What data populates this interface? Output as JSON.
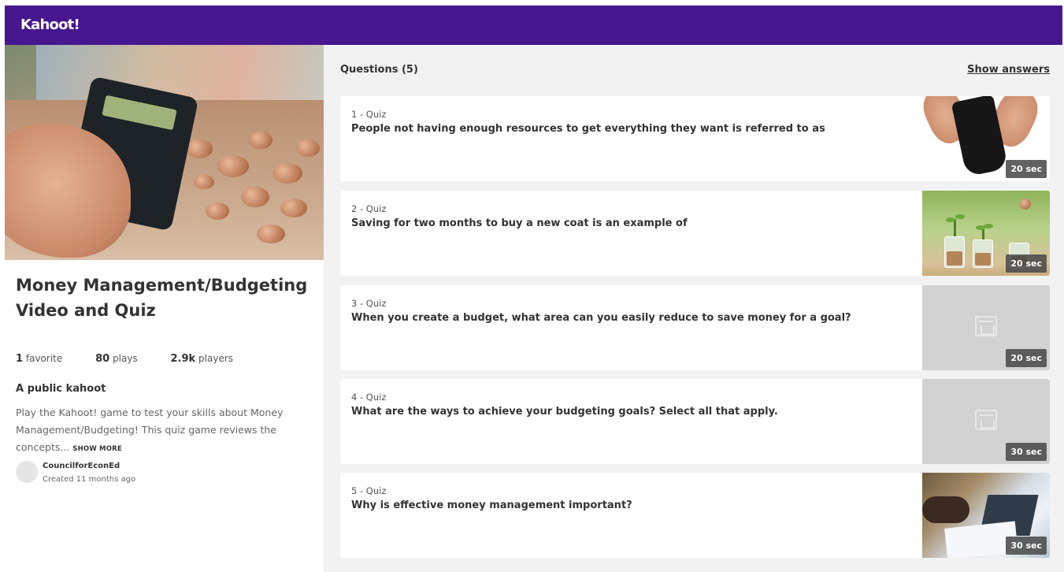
{
  "app": {
    "logo": "Kahoot!"
  },
  "kahoot": {
    "title": "Money Management/Budgeting Video and Quiz",
    "stats": [
      {
        "value": "1",
        "label": "favorite"
      },
      {
        "value": "80",
        "label": "plays"
      },
      {
        "value": "2.9k",
        "label": "players"
      }
    ],
    "visibility": "A public kahoot",
    "description": "Play the Kahoot! game to test your skills about Money Management/Budgeting! This quiz game reviews the concepts...",
    "show_more": "SHOW MORE",
    "author": {
      "name": "CouncilforEconEd",
      "created": "Created 11 months ago"
    }
  },
  "questions_panel": {
    "heading": "Questions (5)",
    "show_answers": "Show answers",
    "questions": [
      {
        "type": "1 - Quiz",
        "text": "People not having enough resources to get everything they want is referred to as",
        "time": "20 sec",
        "image": "wallet-hands"
      },
      {
        "type": "2 - Quiz",
        "text": "Saving for two months to buy a new coat is an example of",
        "time": "20 sec",
        "image": "coin-jars-plants"
      },
      {
        "type": "3 - Quiz",
        "text": "When you create a budget, what area can you easily reduce to save money for a goal?",
        "time": "20 sec",
        "image": "placeholder-image-icon"
      },
      {
        "type": "4 - Quiz",
        "text": "What are the ways to achieve your budgeting goals? Select all that apply.",
        "time": "30 sec",
        "image": "placeholder-image-icon"
      },
      {
        "type": "5 - Quiz",
        "text": "Why is effective money management important?",
        "time": "30 sec",
        "image": "office-charts"
      }
    ]
  },
  "colors": {
    "brand": "#46178f",
    "background": "#f2f2f2",
    "card": "#ffffff",
    "placeholder": "#d2d2d2"
  }
}
